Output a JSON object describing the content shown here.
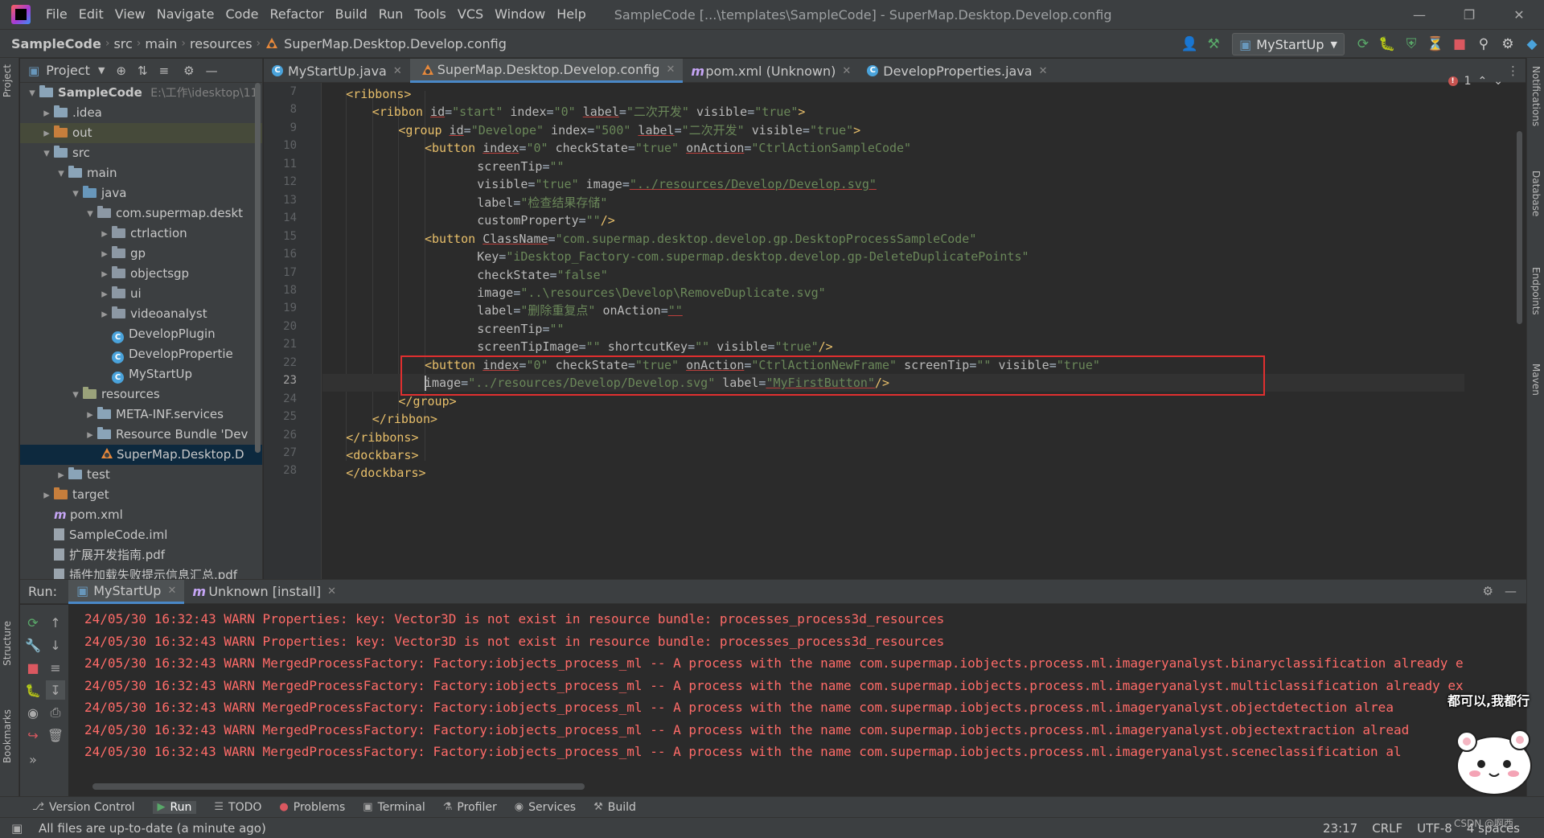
{
  "menubar": {
    "items": [
      "File",
      "Edit",
      "View",
      "Navigate",
      "Code",
      "Refactor",
      "Build",
      "Run",
      "Tools",
      "VCS",
      "Window",
      "Help"
    ],
    "title": "SampleCode [...\\templates\\SampleCode] - SuperMap.Desktop.Develop.config"
  },
  "navbar": {
    "breadcrumbs": [
      "SampleCode",
      "src",
      "main",
      "resources",
      "SuperMap.Desktop.Develop.config"
    ],
    "run_config": "MyStartUp"
  },
  "project": {
    "title": "Project",
    "tree": [
      {
        "label": "SampleCode",
        "hint": "E:\\工作\\idesktop\\11i",
        "icon": "folder-icon",
        "depth": 0,
        "arrow": "v",
        "bold": true
      },
      {
        "label": ".idea",
        "icon": "folder-icon",
        "depth": 1,
        "arrow": ">"
      },
      {
        "label": "out",
        "icon": "folder-orange-icon",
        "depth": 1,
        "arrow": ">",
        "highlight": true
      },
      {
        "label": "src",
        "icon": "folder-icon",
        "depth": 1,
        "arrow": "v"
      },
      {
        "label": "main",
        "icon": "folder-icon",
        "depth": 2,
        "arrow": "v"
      },
      {
        "label": "java",
        "icon": "folder-blue-icon",
        "depth": 3,
        "arrow": "v"
      },
      {
        "label": "com.supermap.deskt",
        "icon": "package-icon",
        "depth": 4,
        "arrow": "v"
      },
      {
        "label": "ctrlaction",
        "icon": "package-icon",
        "depth": 5,
        "arrow": ">"
      },
      {
        "label": "gp",
        "icon": "package-icon",
        "depth": 5,
        "arrow": ">"
      },
      {
        "label": "objectsgp",
        "icon": "package-icon",
        "depth": 5,
        "arrow": ">"
      },
      {
        "label": "ui",
        "icon": "package-icon",
        "depth": 5,
        "arrow": ">"
      },
      {
        "label": "videoanalyst",
        "icon": "package-icon",
        "depth": 5,
        "arrow": ">"
      },
      {
        "label": "DevelopPlugin",
        "icon": "class-icon",
        "depth": 5,
        "arrow": ""
      },
      {
        "label": "DevelopPropertie",
        "icon": "class-icon",
        "depth": 5,
        "arrow": ""
      },
      {
        "label": "MyStartUp",
        "icon": "class-icon",
        "depth": 5,
        "arrow": ""
      },
      {
        "label": "resources",
        "icon": "folder-res-icon",
        "depth": 3,
        "arrow": "v"
      },
      {
        "label": "META-INF.services",
        "icon": "folder-icon",
        "depth": 4,
        "arrow": ">"
      },
      {
        "label": "Resource Bundle 'Dev",
        "icon": "folder-icon",
        "depth": 4,
        "arrow": ">"
      },
      {
        "label": "SuperMap.Desktop.D",
        "icon": "xml-icon",
        "depth": 4,
        "arrow": "",
        "selected": true
      },
      {
        "label": "test",
        "icon": "folder-icon",
        "depth": 2,
        "arrow": ">"
      },
      {
        "label": "target",
        "icon": "folder-orange-icon",
        "depth": 1,
        "arrow": ">"
      },
      {
        "label": "pom.xml",
        "icon": "maven-icon",
        "depth": 1,
        "arrow": ""
      },
      {
        "label": "SampleCode.iml",
        "icon": "file-icon",
        "depth": 1,
        "arrow": ""
      },
      {
        "label": "扩展开发指南.pdf",
        "icon": "file-icon",
        "depth": 1,
        "arrow": ""
      },
      {
        "label": "插件加载失败提示信息汇总.pdf",
        "icon": "file-icon",
        "depth": 1,
        "arrow": ""
      }
    ]
  },
  "editor": {
    "tabs": [
      {
        "label": "MyStartUp.java",
        "icon": "class-icon"
      },
      {
        "label": "SuperMap.Desktop.Develop.config",
        "icon": "xml-icon",
        "active": true
      },
      {
        "label": "pom.xml (Unknown)",
        "icon": "maven-icon"
      },
      {
        "label": "DevelopProperties.java",
        "icon": "class-icon"
      }
    ],
    "error_count": "1",
    "line_numbers": [
      "7",
      "8",
      "9",
      "10",
      "11",
      "12",
      "13",
      "14",
      "15",
      "16",
      "17",
      "18",
      "19",
      "20",
      "21",
      "22",
      "23",
      "24",
      "25",
      "26",
      "27",
      "28"
    ],
    "current_line": "23",
    "lines": [
      [
        {
          "t": "t",
          "s": "<ribbons>"
        }
      ],
      [
        {
          "t": "t",
          "s": "<ribbon "
        },
        {
          "t": "a",
          "s": "id",
          "u": 1
        },
        {
          "t": "p",
          "s": "="
        },
        {
          "t": "v",
          "s": "\"start\" "
        },
        {
          "t": "a",
          "s": "index"
        },
        {
          "t": "p",
          "s": "="
        },
        {
          "t": "v",
          "s": "\"0\" "
        },
        {
          "t": "a",
          "s": "label",
          "u": 1
        },
        {
          "t": "p",
          "s": "="
        },
        {
          "t": "v",
          "s": "\"二次开发\" "
        },
        {
          "t": "a",
          "s": "visible"
        },
        {
          "t": "p",
          "s": "="
        },
        {
          "t": "v",
          "s": "\"true\""
        },
        {
          "t": "t",
          "s": ">"
        }
      ],
      [
        {
          "t": "t",
          "s": "<group "
        },
        {
          "t": "a",
          "s": "id",
          "u": 1
        },
        {
          "t": "p",
          "s": "="
        },
        {
          "t": "v",
          "s": "\"Develope\" "
        },
        {
          "t": "a",
          "s": "index"
        },
        {
          "t": "p",
          "s": "="
        },
        {
          "t": "v",
          "s": "\"500\" "
        },
        {
          "t": "a",
          "s": "label",
          "u": 1
        },
        {
          "t": "p",
          "s": "="
        },
        {
          "t": "v",
          "s": "\"二次开发\" "
        },
        {
          "t": "a",
          "s": "visible"
        },
        {
          "t": "p",
          "s": "="
        },
        {
          "t": "v",
          "s": "\"true\""
        },
        {
          "t": "t",
          "s": ">"
        }
      ],
      [
        {
          "t": "t",
          "s": "<button "
        },
        {
          "t": "a",
          "s": "index",
          "u": 1
        },
        {
          "t": "p",
          "s": "="
        },
        {
          "t": "v",
          "s": "\"0\" "
        },
        {
          "t": "a",
          "s": "checkState"
        },
        {
          "t": "p",
          "s": "="
        },
        {
          "t": "v",
          "s": "\"true\" "
        },
        {
          "t": "a",
          "s": "onAction",
          "u": 1
        },
        {
          "t": "p",
          "s": "="
        },
        {
          "t": "v",
          "s": "\"CtrlActionSampleCode\""
        }
      ],
      [
        {
          "t": "a",
          "s": "screenTip"
        },
        {
          "t": "p",
          "s": "="
        },
        {
          "t": "v",
          "s": "\"\""
        }
      ],
      [
        {
          "t": "a",
          "s": "visible"
        },
        {
          "t": "p",
          "s": "="
        },
        {
          "t": "v",
          "s": "\"true\" "
        },
        {
          "t": "a",
          "s": "image"
        },
        {
          "t": "p",
          "s": "="
        },
        {
          "t": "v",
          "s": "\"../resources/Develop/Develop.svg\"",
          "u": 1
        }
      ],
      [
        {
          "t": "a",
          "s": "label"
        },
        {
          "t": "p",
          "s": "="
        },
        {
          "t": "v",
          "s": "\"检查结果存储\""
        }
      ],
      [
        {
          "t": "a",
          "s": "customProperty"
        },
        {
          "t": "p",
          "s": "="
        },
        {
          "t": "v",
          "s": "\"\""
        },
        {
          "t": "t",
          "s": "/>"
        }
      ],
      [
        {
          "t": "t",
          "s": "<button "
        },
        {
          "t": "a",
          "s": "ClassName",
          "u": 1
        },
        {
          "t": "p",
          "s": "="
        },
        {
          "t": "v",
          "s": "\"com.supermap.desktop.develop.gp.DesktopProcessSampleCode\""
        }
      ],
      [
        {
          "t": "a",
          "s": "Key"
        },
        {
          "t": "p",
          "s": "="
        },
        {
          "t": "v",
          "s": "\"iDesktop_Factory-com.supermap.desktop.develop.gp-DeleteDuplicatePoints\""
        }
      ],
      [
        {
          "t": "a",
          "s": "checkState"
        },
        {
          "t": "p",
          "s": "="
        },
        {
          "t": "v",
          "s": "\"false\""
        }
      ],
      [
        {
          "t": "a",
          "s": "image"
        },
        {
          "t": "p",
          "s": "="
        },
        {
          "t": "v",
          "s": "\"..\\resources\\Develop\\RemoveDuplicate.svg\""
        }
      ],
      [
        {
          "t": "a",
          "s": "label"
        },
        {
          "t": "p",
          "s": "="
        },
        {
          "t": "v",
          "s": "\"删除重复点\" "
        },
        {
          "t": "a",
          "s": "onAction"
        },
        {
          "t": "p",
          "s": "="
        },
        {
          "t": "v",
          "s": "\"\"",
          "u": 1
        }
      ],
      [
        {
          "t": "a",
          "s": "screenTip"
        },
        {
          "t": "p",
          "s": "="
        },
        {
          "t": "v",
          "s": "\"\""
        }
      ],
      [
        {
          "t": "a",
          "s": "screenTipImage"
        },
        {
          "t": "p",
          "s": "="
        },
        {
          "t": "v",
          "s": "\"\" "
        },
        {
          "t": "a",
          "s": "shortcutKey"
        },
        {
          "t": "p",
          "s": "="
        },
        {
          "t": "v",
          "s": "\"\" "
        },
        {
          "t": "a",
          "s": "visible"
        },
        {
          "t": "p",
          "s": "="
        },
        {
          "t": "v",
          "s": "\"true\""
        },
        {
          "t": "t",
          "s": "/>"
        }
      ],
      [
        {
          "t": "t",
          "s": "<button "
        },
        {
          "t": "a",
          "s": "index",
          "u": 1
        },
        {
          "t": "p",
          "s": "="
        },
        {
          "t": "v",
          "s": "\"0\" "
        },
        {
          "t": "a",
          "s": "checkState"
        },
        {
          "t": "p",
          "s": "="
        },
        {
          "t": "v",
          "s": "\"true\" "
        },
        {
          "t": "a",
          "s": "onAction",
          "u": 1
        },
        {
          "t": "p",
          "s": "="
        },
        {
          "t": "v",
          "s": "\"CtrlActionNewFrame\" "
        },
        {
          "t": "a",
          "s": "screenTip"
        },
        {
          "t": "p",
          "s": "="
        },
        {
          "t": "v",
          "s": "\"\" "
        },
        {
          "t": "a",
          "s": "visible"
        },
        {
          "t": "p",
          "s": "="
        },
        {
          "t": "v",
          "s": "\"true\""
        }
      ],
      [
        {
          "t": "a",
          "s": "image"
        },
        {
          "t": "p",
          "s": "="
        },
        {
          "t": "v",
          "s": "\"../resources/Develop/Develop.svg\" "
        },
        {
          "t": "a",
          "s": "label"
        },
        {
          "t": "p",
          "s": "="
        },
        {
          "t": "v",
          "s": "\"MyFirstButton\"",
          "u": 1
        },
        {
          "t": "t",
          "s": "/>"
        }
      ],
      [
        {
          "t": "t",
          "s": "</group>"
        }
      ],
      [
        {
          "t": "t",
          "s": "</ribbon>"
        }
      ],
      [
        {
          "t": "t",
          "s": "</ribbons>"
        }
      ],
      [
        {
          "t": "t",
          "s": "<dockbars>"
        }
      ],
      [
        {
          "t": "t",
          "s": "</dockbars>"
        }
      ]
    ]
  },
  "run": {
    "label": "Run:",
    "tabs": [
      {
        "label": "MyStartUp",
        "active": true
      },
      {
        "label": "Unknown [install]"
      }
    ],
    "log": [
      "24/05/30 16:32:43 WARN Properties: key: Vector3D is not exist in resource bundle: processes_process3d_resources",
      "24/05/30 16:32:43 WARN Properties: key: Vector3D is not exist in resource bundle: processes_process3d_resources",
      "24/05/30 16:32:43 WARN MergedProcessFactory: Factory:iobjects_process_ml -- A process with the name com.supermap.iobjects.process.ml.imageryanalyst.binaryclassification already e",
      "24/05/30 16:32:43 WARN MergedProcessFactory: Factory:iobjects_process_ml -- A process with the name com.supermap.iobjects.process.ml.imageryanalyst.multiclassification already ex",
      "24/05/30 16:32:43 WARN MergedProcessFactory: Factory:iobjects_process_ml -- A process with the name com.supermap.iobjects.process.ml.imageryanalyst.objectdetection alrea",
      "24/05/30 16:32:43 WARN MergedProcessFactory: Factory:iobjects_process_ml -- A process with the name com.supermap.iobjects.process.ml.imageryanalyst.objectextraction alread",
      "24/05/30 16:32:43 WARN MergedProcessFactory: Factory:iobjects_process_ml -- A process with the name com.supermap.iobjects.process.ml.imageryanalyst.sceneclassification al"
    ]
  },
  "bottom_tabs": [
    "Version Control",
    "Run",
    "TODO",
    "Problems",
    "Terminal",
    "Profiler",
    "Services",
    "Build"
  ],
  "side_tabs": {
    "left": [
      "Project",
      "Structure",
      "Bookmarks"
    ],
    "right": [
      "Notifications",
      "Database",
      "Endpoints",
      "Maven"
    ]
  },
  "status": {
    "message": "All files are up-to-date (a minute ago)",
    "position": "23:17",
    "line_sep": "CRLF",
    "encoding": "UTF-8",
    "indent": "4 spaces"
  },
  "overlay": {
    "sticker_text": "都可以,我都行",
    "watermark": "CSDN @啊西"
  },
  "colors": {
    "tag": "#e8bf6a",
    "attr": "#bababa",
    "value": "#6a8759",
    "warn": "#ff6b68",
    "highlight_box": "#e02f2f"
  }
}
